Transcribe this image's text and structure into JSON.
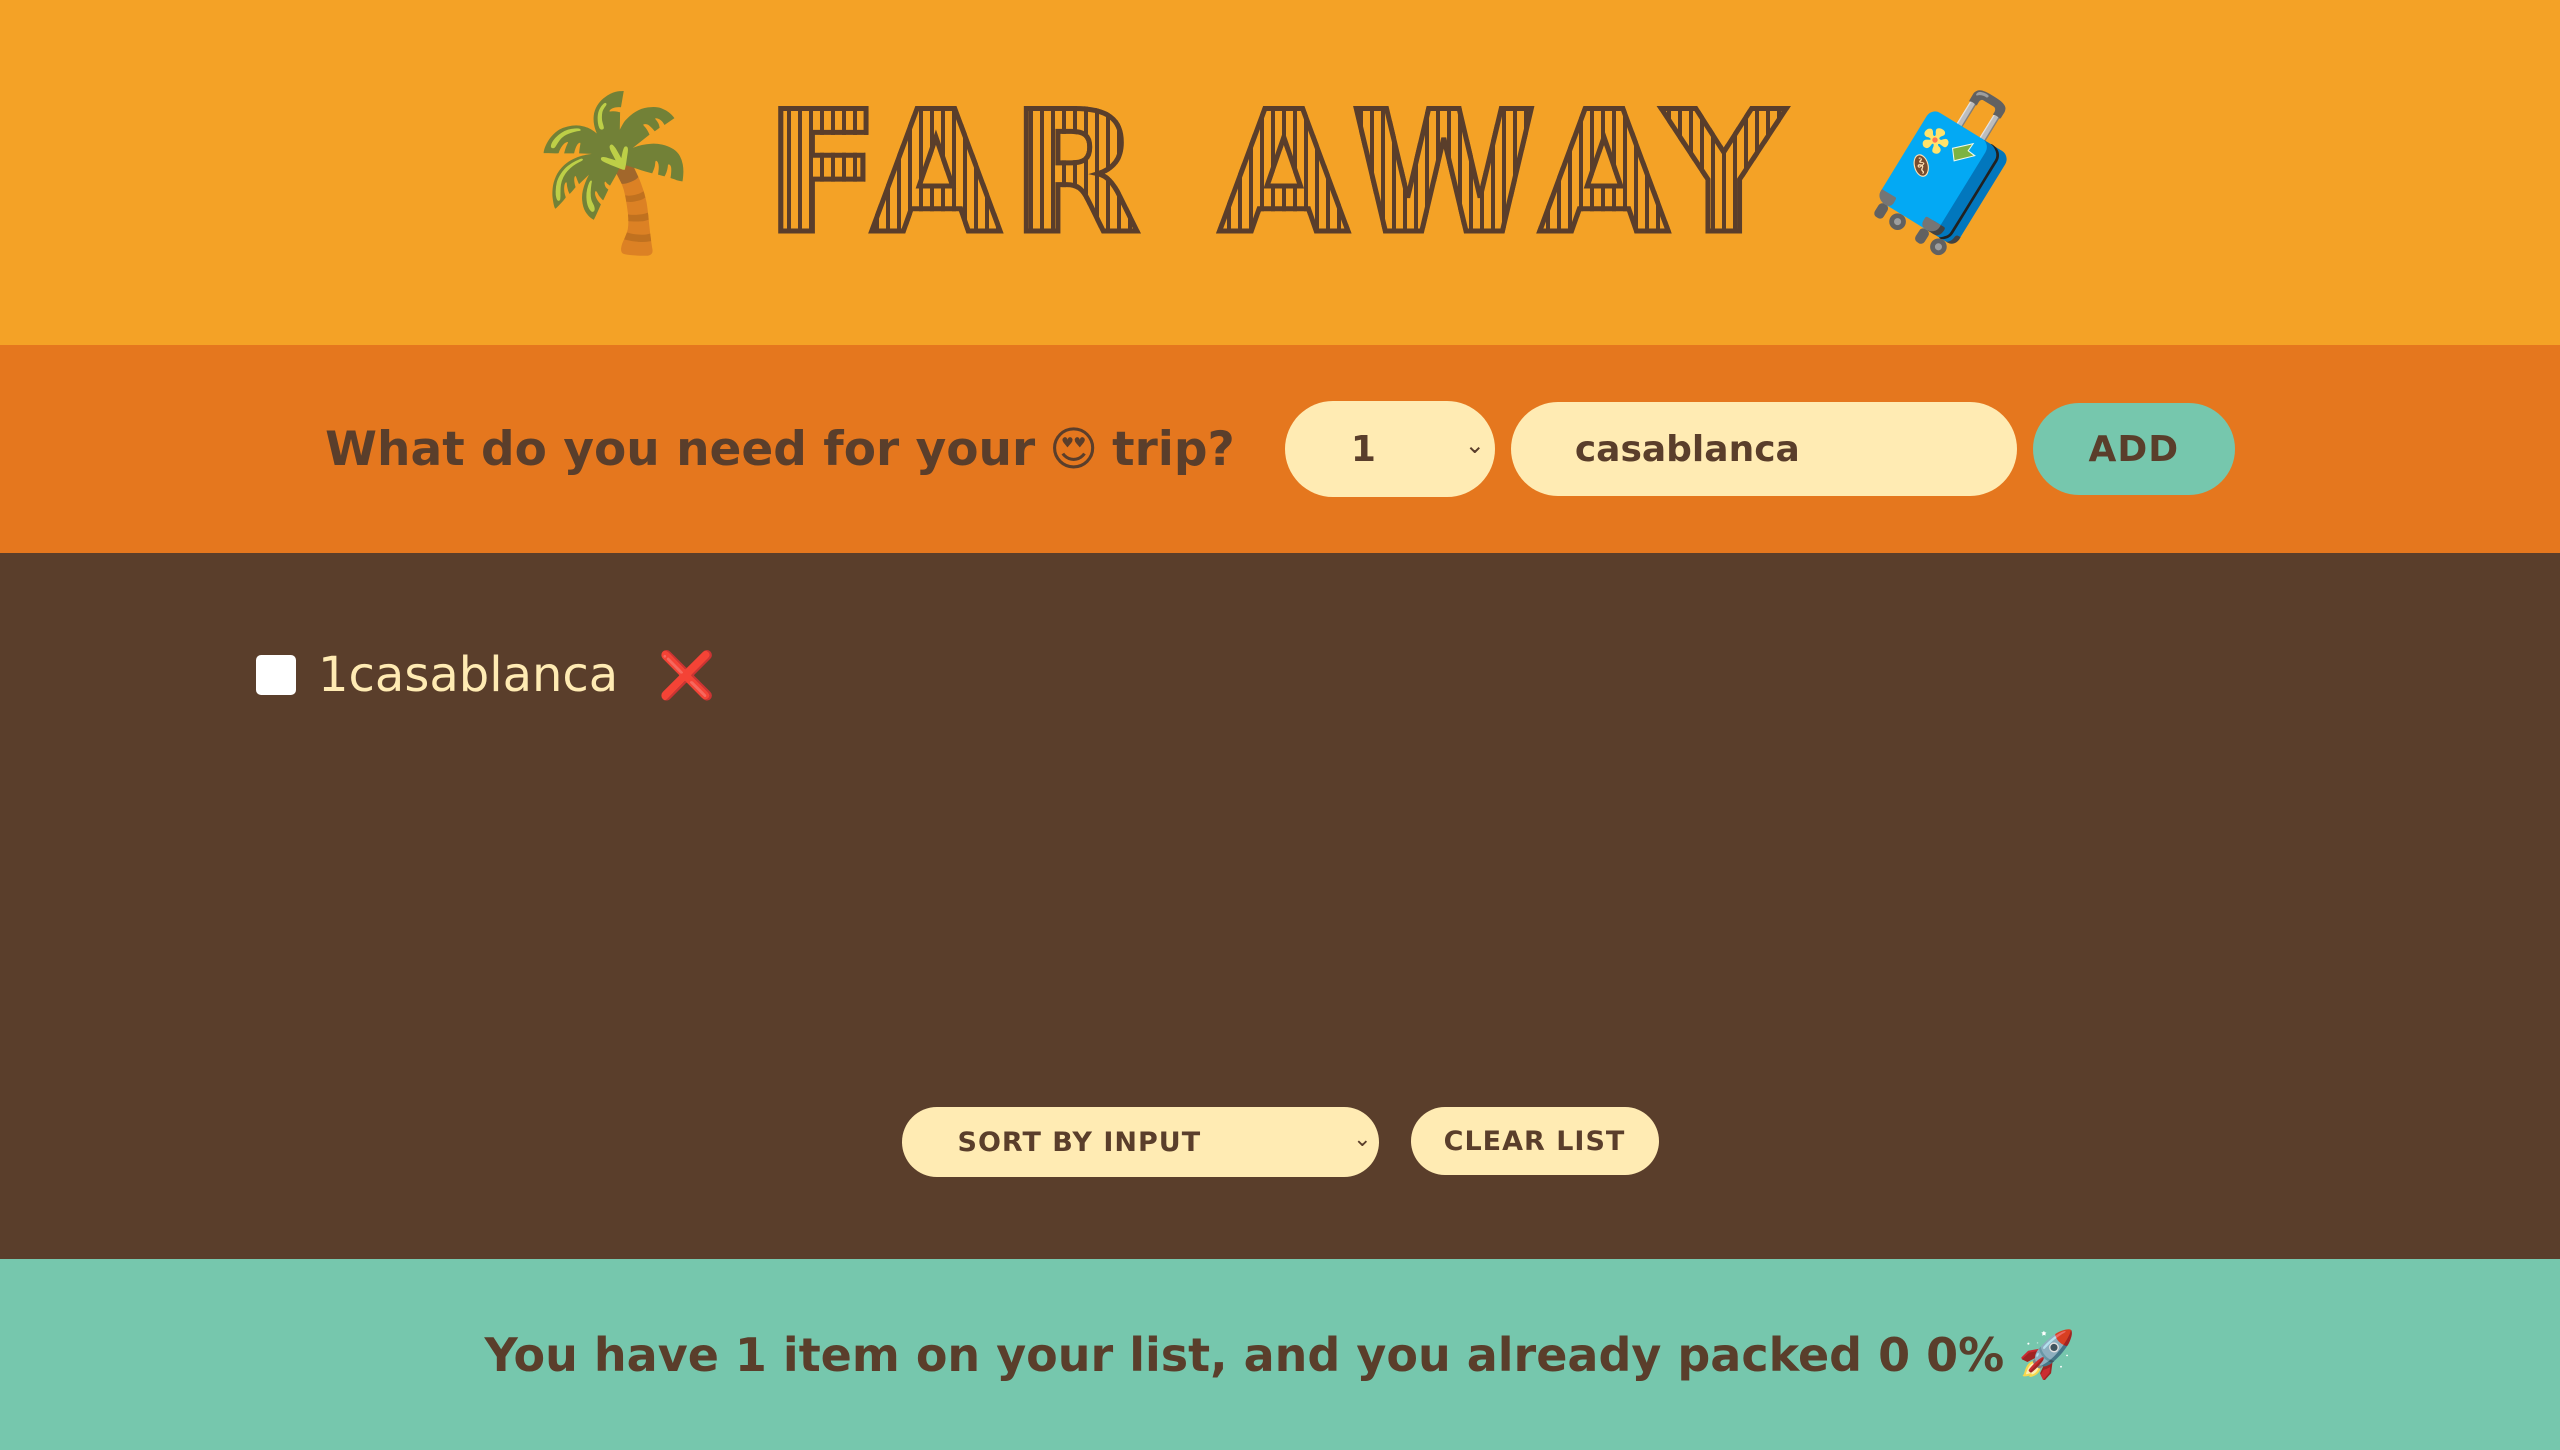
{
  "header": {
    "title": "FAR AWAY",
    "left_icon": "palm-tree-icon",
    "right_icon": "suitcase-icon",
    "left_glyph": "🌴",
    "right_glyph": "🧳"
  },
  "form": {
    "question_before": "What do you need for your",
    "question_emoji": "😍",
    "question_after": "trip?",
    "quantity_value": "1",
    "description_value": "casablanca",
    "add_label": "ADD"
  },
  "items": [
    {
      "quantity": "1",
      "description": "casablanca",
      "label": "1casablanca",
      "packed": false
    }
  ],
  "delete_glyph": "❌",
  "chevron_glyph": "⌄",
  "actions": {
    "sort_selected": "SORT BY INPUT",
    "clear_label": "CLEAR LIST"
  },
  "stats": {
    "text": "You have 1 item on your list, and you already packed 0 0%",
    "emoji": "🚀"
  },
  "colors": {
    "header_bg": "#f4a226",
    "form_bg": "#e5771e",
    "list_bg": "#5a3e2b",
    "stats_bg": "#76c7ad",
    "pill_bg": "#ffebb3",
    "delete": "#e01b1b"
  }
}
